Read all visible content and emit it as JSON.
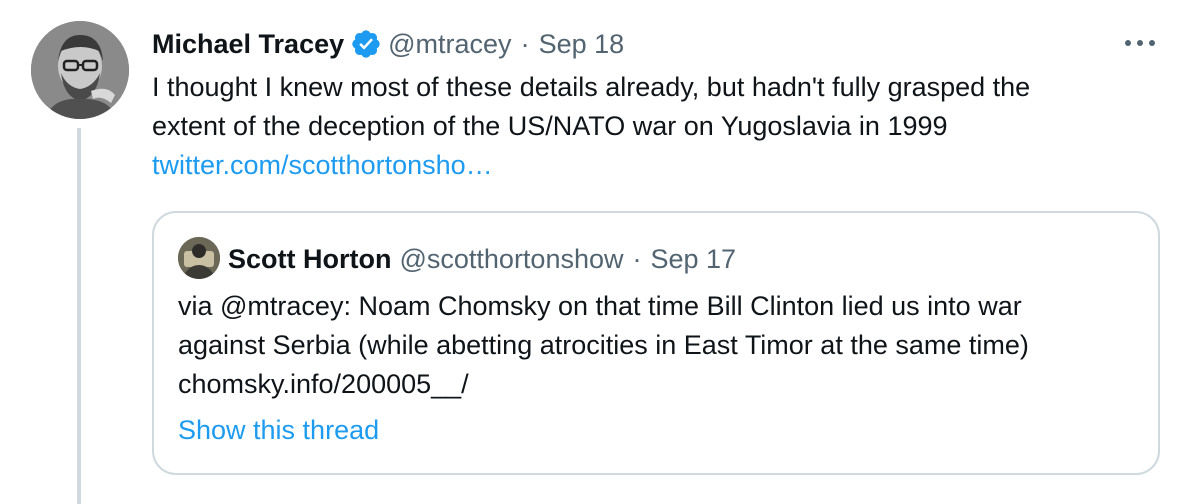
{
  "tweet": {
    "author_name": "Michael Tracey",
    "handle": "@mtracey",
    "separator": "·",
    "date": "Sep 18",
    "text_lines": [
      "I thought I knew most of these details already, but hadn't fully grasped the",
      "extent of the deception of the US/NATO war on Yugoslavia in 1999"
    ],
    "link": "twitter.com/scotthortonsho…",
    "verified_icon": "verified-badge-icon",
    "more_icon": "more-options-icon"
  },
  "quote": {
    "author_name": "Scott Horton",
    "handle": "@scotthortonshow",
    "separator": "·",
    "date": "Sep 17",
    "text_lines": [
      "via @mtracey: Noam Chomsky on that time Bill Clinton lied us into war",
      "against Serbia (while abetting atrocities in East Timor at the same time)",
      "chomsky.info/200005__/"
    ],
    "show_thread": "Show this thread"
  },
  "colors": {
    "accent": "#1d9bf0",
    "secondary_text": "#536471",
    "border": "#cfd9de"
  }
}
